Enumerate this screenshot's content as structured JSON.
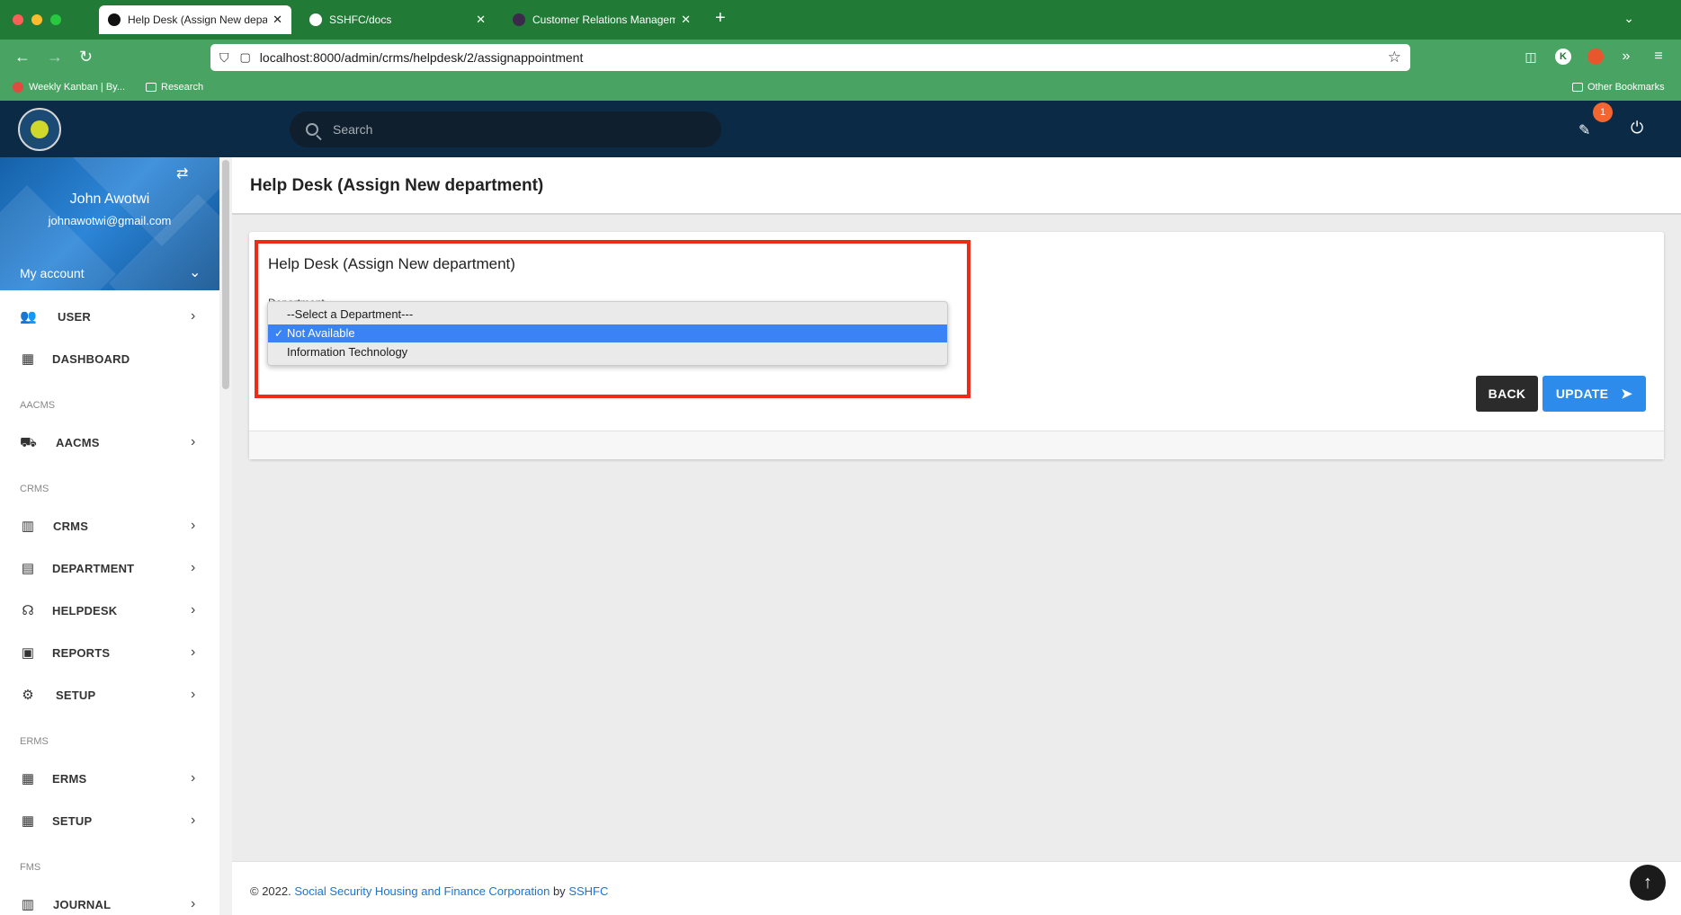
{
  "browser": {
    "tabs": [
      {
        "title": "Help Desk (Assign New departm",
        "active": true
      },
      {
        "title": "SSHFC/docs",
        "active": false
      },
      {
        "title": "Customer Relations Managemen",
        "active": false
      }
    ],
    "url": "localhost:8000/admin/crms/helpdesk/2/assignappointment",
    "bookmarks": [
      {
        "label": "Weekly Kanban | By..."
      },
      {
        "label": "Research"
      }
    ],
    "other_bookmarks": "Other Bookmarks",
    "extension_k": "K"
  },
  "header": {
    "search_placeholder": "Search",
    "notification_count": "1"
  },
  "sidebar": {
    "user_name": "John Awotwi",
    "user_email": "johnawotwi@gmail.com",
    "my_account": "My account",
    "items": [
      {
        "label": "USER",
        "icon": "users-icon"
      },
      {
        "label": "DASHBOARD",
        "icon": "building-icon"
      },
      {
        "section": "AACMS"
      },
      {
        "label": "AACMS",
        "icon": "car-icon"
      },
      {
        "section": "CRMS"
      },
      {
        "label": "CRMS",
        "icon": "columns-icon"
      },
      {
        "label": "DEPARTMENT",
        "icon": "office-icon"
      },
      {
        "label": "HELPDESK",
        "icon": "headset-icon"
      },
      {
        "label": "REPORTS",
        "icon": "clipboard-icon"
      },
      {
        "label": "SETUP",
        "icon": "gears-icon"
      },
      {
        "section": "ERMS"
      },
      {
        "label": "ERMS",
        "icon": "building-icon"
      },
      {
        "label": "SETUP",
        "icon": "building-icon"
      },
      {
        "section": "FMS"
      },
      {
        "label": "JOURNAL",
        "icon": "books-icon"
      }
    ]
  },
  "main": {
    "page_title": "Help Desk (Assign New department)",
    "card_title": "Help Desk (Assign New department)",
    "field_label": "Department",
    "dropdown_options": [
      "--Select a Department---",
      "Not Available",
      "Information Technology"
    ],
    "selected_option": "Not Available",
    "back_label": "BACK",
    "update_label": "UPDATE"
  },
  "footer": {
    "copyright": "© 2022. ",
    "org_link": "Social Security Housing and Finance Corporation",
    "by": " by ",
    "brand_link": "SSHFC"
  },
  "colors": {
    "tab_bar": "#217a36",
    "nav_bar": "#49a463",
    "app_header": "#0b2a45",
    "highlight_border": "#ee2b19",
    "update_button": "#2d8ceb",
    "back_button": "#2b2b2b",
    "selected_option": "#3b82f6"
  }
}
